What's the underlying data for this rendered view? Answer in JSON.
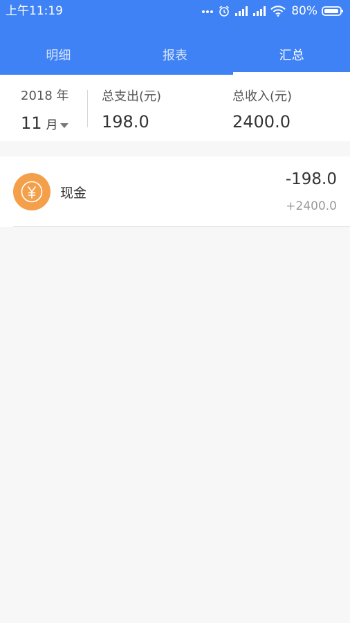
{
  "status_bar": {
    "time": "上午11:19",
    "battery": "80%",
    "icons": [
      "more-dots-icon",
      "alarm-icon",
      "signal-icon",
      "signal-icon",
      "wifi-icon",
      "battery-icon"
    ]
  },
  "tabs": [
    {
      "label": "明细",
      "active": false
    },
    {
      "label": "报表",
      "active": false
    },
    {
      "label": "汇总",
      "active": true
    }
  ],
  "summary": {
    "year": "2018 年",
    "month": "11",
    "month_unit": "月",
    "expense_label": "总支出(元)",
    "expense_value": "198.0",
    "income_label": "总收入(元)",
    "income_value": "2400.0"
  },
  "accounts": [
    {
      "icon": "yen-icon",
      "name": "现金",
      "expense": "-198.0",
      "income": "+2400.0"
    }
  ],
  "colors": {
    "primary": "#3f82f5",
    "accent": "#f4a04a",
    "background": "#f7f7f7"
  }
}
